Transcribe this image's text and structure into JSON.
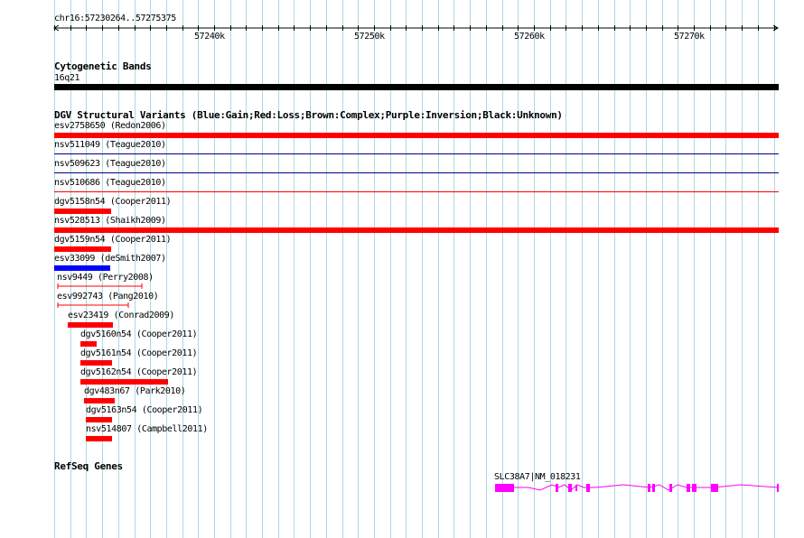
{
  "ruler": {
    "locus": "chr16:57230264..57275375",
    "ticks": [
      "57240k",
      "57250k",
      "57260k",
      "57270k"
    ]
  },
  "cytobands": {
    "title": "Cytogenetic Bands",
    "band": "16q21"
  },
  "dgv": {
    "title": "DGV Structural Variants (Blue:Gain;Red:Loss;Brown:Complex;Purple:Inversion;Black:Unknown)",
    "variants": [
      {
        "label": "esv2758650 (Redon2006)",
        "color": "#ff0000"
      },
      {
        "label": "nsv511049 (Teague2010)",
        "color": "#000080"
      },
      {
        "label": "nsv509623 (Teague2010)",
        "color": "#000080"
      },
      {
        "label": "nsv510686 (Teague2010)",
        "color": "#ff0000"
      },
      {
        "label": "dgv5158n54 (Cooper2011)",
        "color": "#ff0000"
      },
      {
        "label": "nsv528513 (Shaikh2009)",
        "color": "#ff0000"
      },
      {
        "label": "dgv5159n54 (Cooper2011)",
        "color": "#ff0000"
      },
      {
        "label": "esv33099 (deSmith2007)",
        "color": "#0000ff"
      },
      {
        "label": "nsv9449 (Perry2008)",
        "color": "#ff0000"
      },
      {
        "label": "esv992743 (Pang2010)",
        "color": "#ff0000"
      },
      {
        "label": "esv23419 (Conrad2009)",
        "color": "#ff0000"
      },
      {
        "label": "dgv5160n54 (Cooper2011)",
        "color": "#ff0000"
      },
      {
        "label": "dgv5161n54 (Cooper2011)",
        "color": "#ff0000"
      },
      {
        "label": "dgv5162n54 (Cooper2011)",
        "color": "#ff0000"
      },
      {
        "label": "dgv483n67 (Park2010)",
        "color": "#ff0000"
      },
      {
        "label": "dgv5163n54 (Cooper2011)",
        "color": "#ff0000"
      },
      {
        "label": "nsv514807 (Campbell2011)",
        "color": "#ff0000"
      }
    ]
  },
  "refseq": {
    "title": "RefSeq Genes",
    "gene": "SLC38A7|NM_018231",
    "color": "#ff00ff"
  },
  "colors": {
    "grid": "#add8e6",
    "cytoband": "#000000"
  }
}
